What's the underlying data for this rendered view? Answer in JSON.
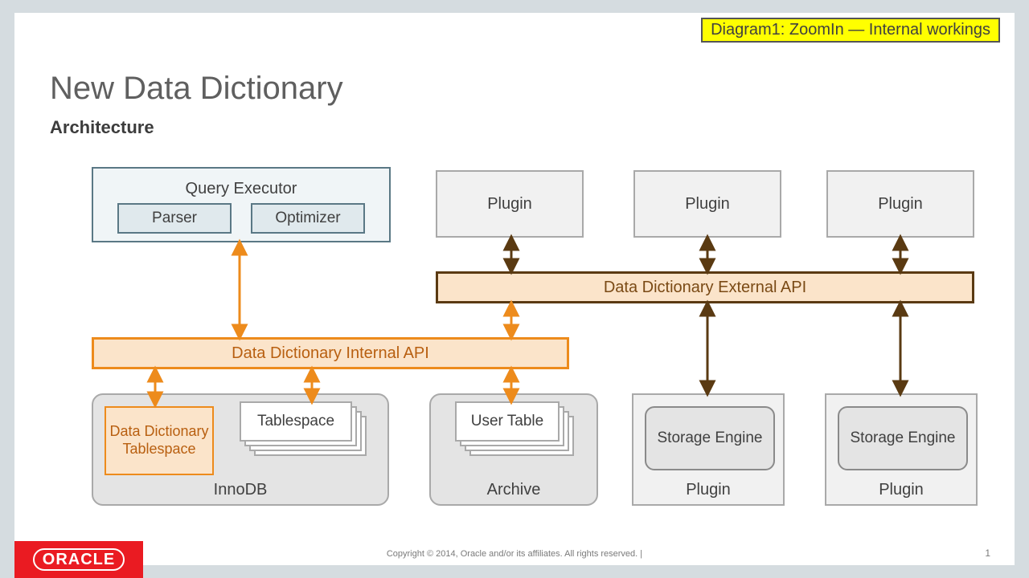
{
  "badge": "Diagram1:  ZoomIn — Internal workings",
  "title": "New Data Dictionary",
  "subtitle": "Architecture",
  "query_executor": {
    "title": "Query Executor",
    "parser": "Parser",
    "optimizer": "Optimizer"
  },
  "plugins_top": [
    "Plugin",
    "Plugin",
    "Plugin"
  ],
  "external_api": "Data Dictionary External API",
  "internal_api": "Data Dictionary Internal API",
  "innodb": {
    "label": "InnoDB",
    "dd_tablespace": "Data Dictionary Tablespace",
    "tablespace": "Tablespace"
  },
  "archive": {
    "label": "Archive",
    "user_table": "User Table"
  },
  "plugin_groups": [
    {
      "label": "Plugin",
      "storage_engine": "Storage Engine"
    },
    {
      "label": "Plugin",
      "storage_engine": "Storage Engine"
    }
  ],
  "footer": {
    "oracle": "ORACLE",
    "copyright": "Copyright © 2014, Oracle and/or its affiliates. All rights reserved.   |",
    "page": "1"
  }
}
